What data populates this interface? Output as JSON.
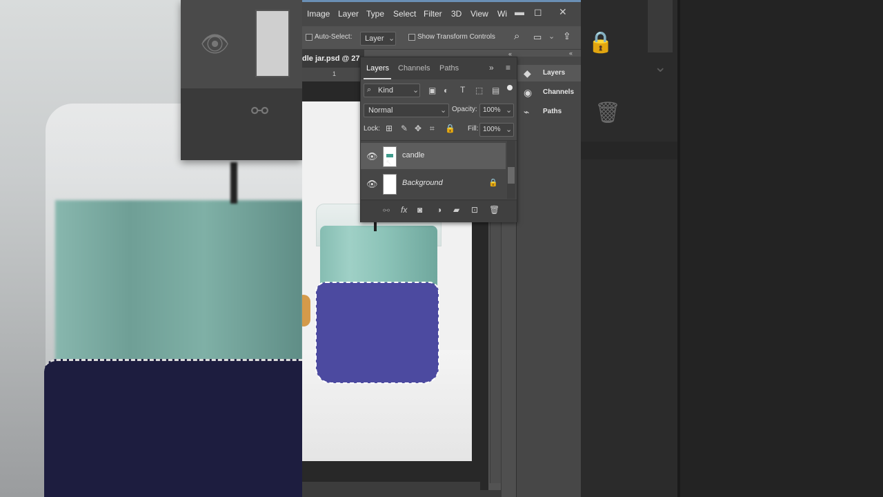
{
  "menu": {
    "items": [
      "Image",
      "Layer",
      "Type",
      "Select",
      "Filter",
      "3D",
      "View",
      "Wi"
    ],
    "minimize": "▬",
    "maximize": "◻",
    "close": "✕"
  },
  "options": {
    "auto_select_label": "Auto-Select:",
    "auto_select_target": "Layer",
    "show_transform_label": "Show Transform Controls"
  },
  "document": {
    "tab_title": "dle jar.psd @ 27.",
    "ruler_mark": "1"
  },
  "layers_panel": {
    "tabs": [
      "Layers",
      "Channels",
      "Paths"
    ],
    "active_tab": "Layers",
    "filter_kind": "Kind",
    "blend_mode": "Normal",
    "opacity_label": "Opacity:",
    "opacity_value": "100%",
    "lock_label": "Lock:",
    "fill_label": "Fill:",
    "fill_value": "100%",
    "layers": [
      {
        "name": "candle",
        "visible": true,
        "selected": true,
        "locked": false
      },
      {
        "name": "Background",
        "visible": true,
        "selected": false,
        "locked": true
      }
    ]
  },
  "dock": {
    "items": [
      {
        "label": "Layers",
        "icon": "layers-icon",
        "active": true
      },
      {
        "label": "Channels",
        "icon": "channels-icon",
        "active": false
      },
      {
        "label": "Paths",
        "icon": "paths-icon",
        "active": false
      }
    ]
  },
  "colors": {
    "selection_fill": "#4c4aa0",
    "wax": "#8cc3b8",
    "panel_bg": "#4a4a4a",
    "title_accent": "#6a8fb5"
  }
}
